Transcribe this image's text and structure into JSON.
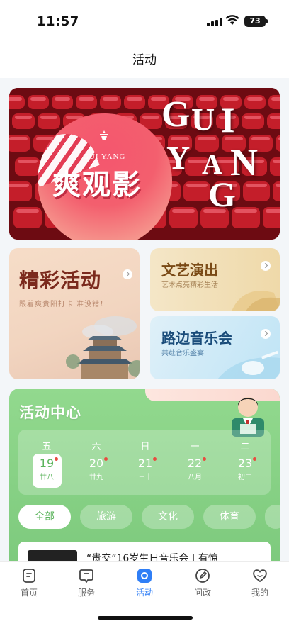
{
  "status_bar": {
    "time": "11:57",
    "battery": "73"
  },
  "nav": {
    "title": "活动"
  },
  "banner": {
    "subtitle": "GUI YANG",
    "title": "爽观影",
    "letters": [
      "G",
      "U",
      "I",
      "Y",
      "A",
      "N",
      "G"
    ]
  },
  "cards": {
    "featured": {
      "title": "精彩活动",
      "subtitle": "跟着爽贵阳打卡  准没错！"
    },
    "performance": {
      "title": "文艺演出",
      "subtitle": "艺术点亮精彩生活"
    },
    "music": {
      "title": "路边音乐会",
      "subtitle": "共赴音乐盛宴"
    }
  },
  "activity_center": {
    "title": "活动中心",
    "days": [
      {
        "weekday": "五",
        "date": "19",
        "lunar": "廿八",
        "selected": true,
        "has_event": true
      },
      {
        "weekday": "六",
        "date": "20",
        "lunar": "廿九",
        "selected": false,
        "has_event": true
      },
      {
        "weekday": "日",
        "date": "21",
        "lunar": "三十",
        "selected": false,
        "has_event": true
      },
      {
        "weekday": "一",
        "date": "22",
        "lunar": "八月",
        "selected": false,
        "has_event": true
      },
      {
        "weekday": "二",
        "date": "23",
        "lunar": "初二",
        "selected": false,
        "has_event": true
      }
    ],
    "categories": [
      "全部",
      "旅游",
      "文化",
      "体育"
    ],
    "active_category": "全部",
    "first_article": {
      "title": "“贵交”16岁生日音乐会 | 有惊"
    }
  },
  "tabbar": {
    "items": [
      {
        "label": "首页",
        "icon": "home-doc-icon",
        "active": false
      },
      {
        "label": "服务",
        "icon": "service-chat-icon",
        "active": false
      },
      {
        "label": "活动",
        "icon": "activity-icon",
        "active": true
      },
      {
        "label": "问政",
        "icon": "pen-icon",
        "active": false
      },
      {
        "label": "我的",
        "icon": "heart-profile-icon",
        "active": false
      }
    ]
  },
  "colors": {
    "accent": "#2f7ef6",
    "green": "#7cc97c",
    "banner_red": "#7a0e14",
    "event_dot": "#e84b40"
  }
}
